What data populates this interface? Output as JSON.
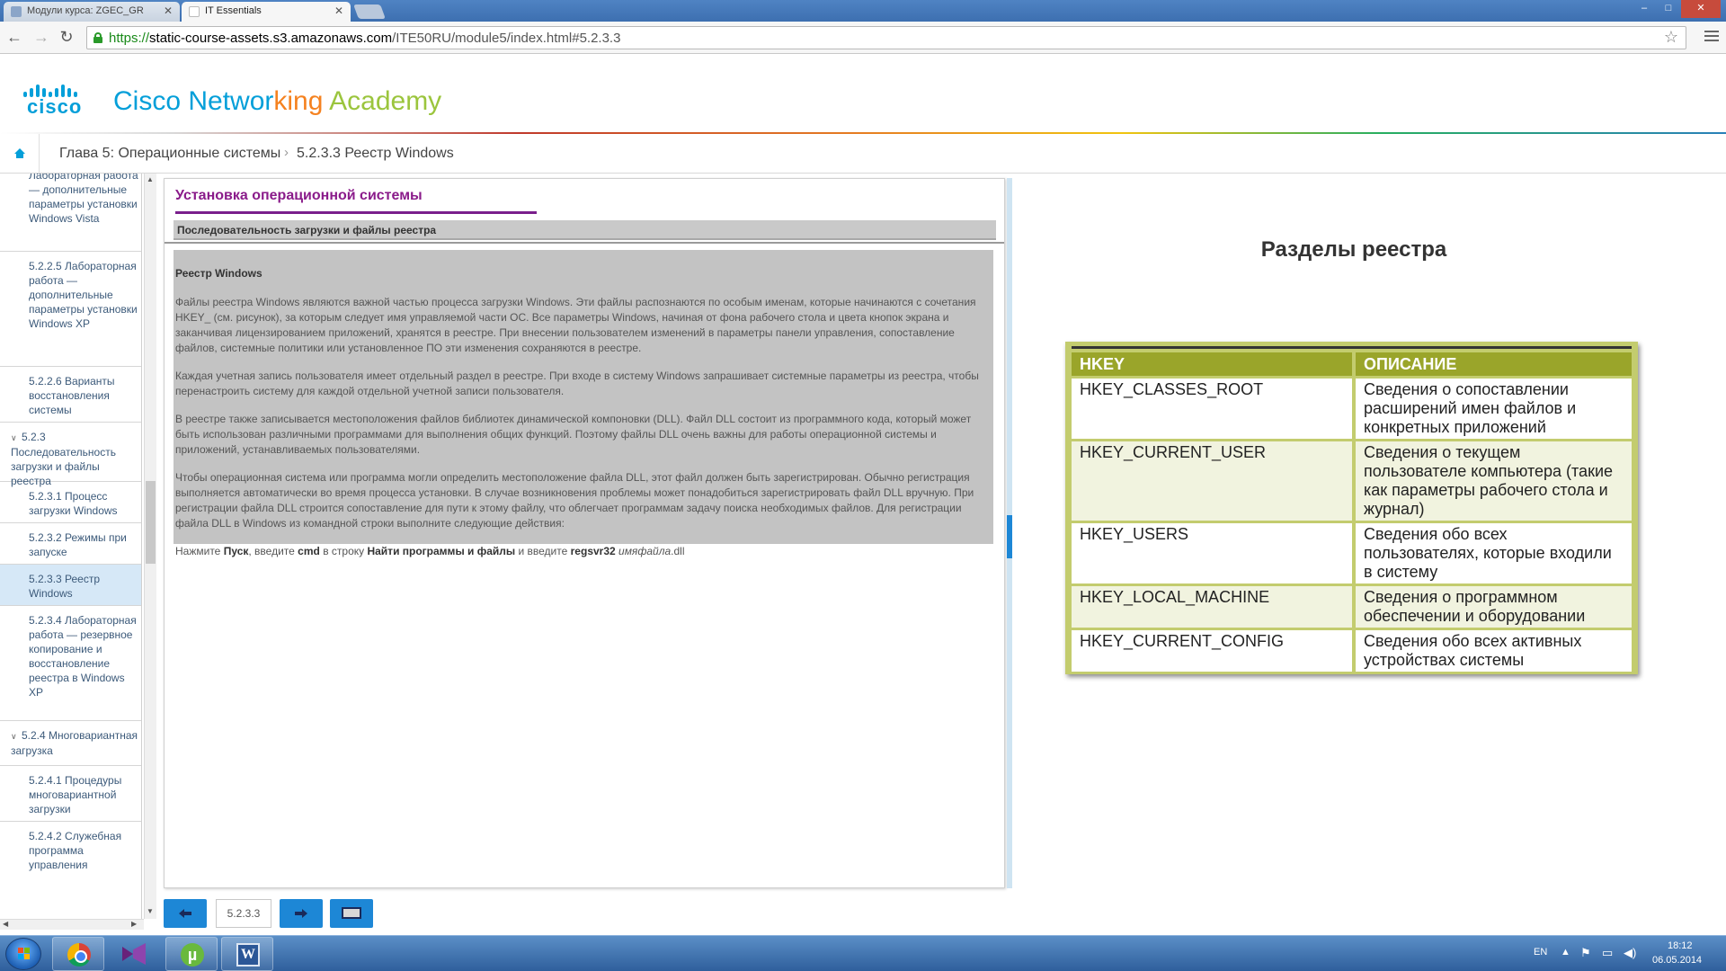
{
  "browser": {
    "tabs": [
      {
        "title": "Модули курса: ZGEC_GR",
        "active": false
      },
      {
        "title": "IT Essentials",
        "active": true
      }
    ],
    "url_scheme": "https://",
    "url_host": "static-course-assets.s3.amazonaws.com",
    "url_path": "/ITE50RU/module5/index.html#5.2.3.3",
    "window_controls": [
      "–",
      "□",
      "✕"
    ]
  },
  "header": {
    "cisco_wordmark": "cisco",
    "academy_words": [
      "Cisco",
      "Networ",
      "king",
      "Academy"
    ]
  },
  "breadcrumb": {
    "chapter": "Глава 5: Операционные системы",
    "separator": "›",
    "current": "5.2.3.3 Реестр Windows"
  },
  "sidebar": {
    "items": [
      {
        "label": "Лабораторная работа — дополнительные параметры установки Windows Vista",
        "type": "item"
      },
      {
        "label": "5.2.2.5 Лабораторная работа — дополнительные параметры установки Windows XP",
        "type": "item"
      },
      {
        "label": "5.2.2.6 Варианты восстановления системы",
        "type": "item"
      },
      {
        "label": "5.2.3 Последовательность загрузки и файлы реестра",
        "type": "section"
      },
      {
        "label": "5.2.3.1 Процесс загрузки Windows",
        "type": "item"
      },
      {
        "label": "5.2.3.2 Режимы при запуске",
        "type": "item"
      },
      {
        "label": "5.2.3.3 Реестр Windows",
        "type": "item",
        "active": true
      },
      {
        "label": "5.2.3.4 Лабораторная работа — резервное копирование и восстановление реестра в Windows XP",
        "type": "item"
      },
      {
        "label": "5.2.4 Многовариантная загрузка",
        "type": "section"
      },
      {
        "label": "5.2.4.1 Процедуры многовариантной загрузки",
        "type": "item"
      },
      {
        "label": "5.2.4.2 Служебная программа управления",
        "type": "item"
      }
    ]
  },
  "content": {
    "title": "Установка операционной системы",
    "subheading": "Последовательность загрузки и файлы реестра",
    "section_heading": "Реестр Windows",
    "paragraphs": [
      "Файлы реестра Windows являются важной частью процесса загрузки Windows. Эти файлы распознаются по особым именам, которые начинаются с сочетания HKEY_ (см. рисунок), за которым следует имя управляемой части ОС. Все параметры Windows, начиная от фона рабочего стола и цвета кнопок экрана и заканчивая лицензированием приложений, хранятся в реестре. При внесении пользователем изменений в параметры панели управления, сопоставление файлов, системные политики или установленное ПО эти изменения сохраняются в реестре.",
      "Каждая учетная запись пользователя имеет отдельный раздел в реестре. При входе в систему Windows запрашивает системные параметры из реестра, чтобы перенастроить систему для каждой отдельной учетной записи пользователя.",
      "В реестре также записывается местоположения файлов библиотек динамической компоновки (DLL). Файл DLL состоит из программного кода, который может быть использован различными программами для выполнения общих функций. Поэтому файлы DLL очень важны для работы операционной системы и приложений, устанавливаемых пользователями.",
      "Чтобы операционная система или программа могли определить местоположение файла DLL, этот файл должен быть зарегистрирован. Обычно регистрация выполняется автоматически во время процесса установки. В случае возникновения проблемы может понадобиться зарегистрировать файл DLL вручную. При регистрации файла DLL строится сопоставление для пути к этому файлу, что облегчает программам задачу поиска необходимых файлов. Для регистрации файла DLL в Windows из командной строки выполните следующие действия:"
    ],
    "instruction": {
      "part1": "Нажмите ",
      "b1": "Пуск",
      "part2": ", введите ",
      "b2": "cmd",
      "part3": " в строку ",
      "b3": "Найти программы и файлы",
      "part4": " и введите ",
      "b4": "regsvr32",
      "part5": " ",
      "i1": "имяфайла",
      "part6": ".dll"
    }
  },
  "bottom_nav": {
    "page_label": "5.2.3.3"
  },
  "figure": {
    "title": "Разделы реестра",
    "headers": [
      "HKEY",
      "ОПИСАНИЕ"
    ],
    "rows": [
      {
        "key": "HKEY_CLASSES_ROOT",
        "desc": "Сведения о сопоставлении расширений имен файлов и конкретных приложений"
      },
      {
        "key": "HKEY_CURRENT_USER",
        "desc": "Сведения о текущем пользователе компьютера (такие как параметры рабочего стола и журнал)"
      },
      {
        "key": "HKEY_USERS",
        "desc": "Сведения обо всех пользователях, которые входили в систему"
      },
      {
        "key": "HKEY_LOCAL_MACHINE",
        "desc": "Сведения о программном обеспечении и оборудовании"
      },
      {
        "key": "HKEY_CURRENT_CONFIG",
        "desc": "Сведения обо всех активных устройствах системы"
      }
    ]
  },
  "taskbar": {
    "language": "EN",
    "time": "18:12",
    "date": "06.05.2014",
    "word_letter": "W",
    "utorrent_letter": "µ"
  },
  "colors": {
    "accent_blue": "#1d87d6",
    "cisco_blue": "#049fd9",
    "title_purple": "#8a1b8a",
    "table_olive": "#9aa52a"
  }
}
